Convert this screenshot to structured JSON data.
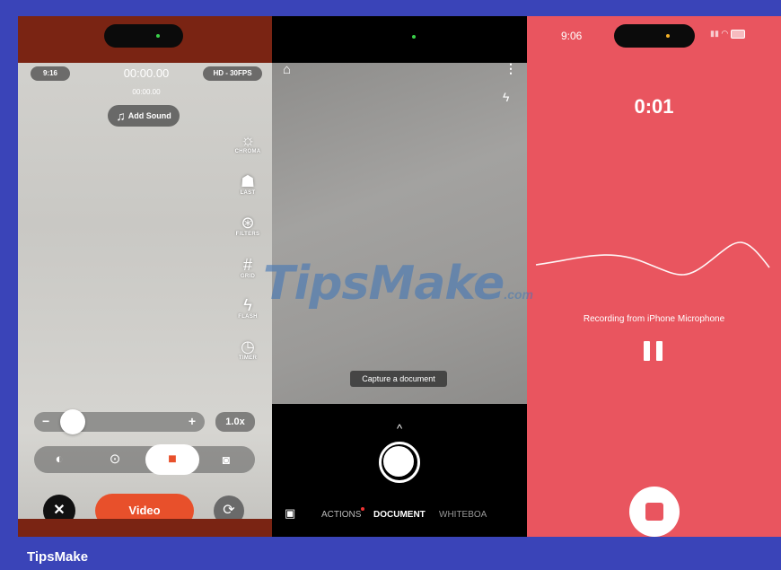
{
  "footer": {
    "caption": "TipsMake"
  },
  "watermark": {
    "main": "TipsMake",
    "suffix": ".com"
  },
  "panel1": {
    "status_time": "9:16",
    "timer": "00:00.00",
    "sub_timer": "00:00.00",
    "quality": "HD - 30FPS",
    "add_sound_label": "Add Sound",
    "side_tools": [
      {
        "icon": "chroma-icon",
        "label": "CHROMA"
      },
      {
        "icon": "ghost-icon",
        "label": "LAST"
      },
      {
        "icon": "filters-icon",
        "label": "FILTERS"
      },
      {
        "icon": "grid-icon",
        "label": "GRID"
      },
      {
        "icon": "flash-icon",
        "label": "FLASH"
      },
      {
        "icon": "timer-icon",
        "label": "TIMER"
      }
    ],
    "zoom_minus": "−",
    "zoom_plus": "+",
    "zoom_value": "1.0x",
    "zoom_slider_level": 0.18,
    "record_button_label": "Video",
    "close_symbol": "✕"
  },
  "panel2": {
    "tooltip": "Capture a document",
    "chevron": "^",
    "modes": [
      "ACTIONS",
      "DOCUMENT",
      "WHITEBOA"
    ],
    "active_mode": "DOCUMENT"
  },
  "panel3": {
    "status_time": "9:06",
    "elapsed": "0:01",
    "recording_source": "Recording from iPhone Microphone"
  },
  "colors": {
    "brand_orange": "#e8502b",
    "recorder_red": "#e9555f",
    "frame_blue": "#3a44b8"
  }
}
